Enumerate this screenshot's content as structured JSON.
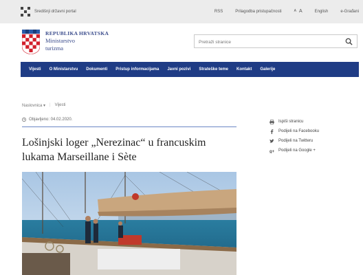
{
  "topbar": {
    "gov_label": "Središnji državni portal",
    "links": [
      "RSS",
      "Prilagodba pristupačnosti",
      "A",
      "A",
      "English",
      "e-Građani"
    ]
  },
  "header": {
    "ministry_line1": "REPUBLIKA HRVATSKA",
    "ministry_line2": "Ministarstvo",
    "ministry_line3": "turizma"
  },
  "search": {
    "placeholder": "Pretraži stranice"
  },
  "nav": {
    "items": [
      "Vijesti",
      "O Ministarstvu",
      "Dokumenti",
      "Pristup informacijama",
      "Javni pozivi",
      "Strateške teme",
      "Kontakt",
      "Galerije"
    ]
  },
  "breadcrumb": {
    "home": "Naslovnica",
    "current": "Vijesti"
  },
  "article": {
    "date": "Objavljeno: 04.02.2020.",
    "title": "Lošinjski loger „Nerezinac“ u francuskim lukama Marseillane i Sète"
  },
  "share": {
    "items": [
      "Ispiši stranicu",
      "Podijeli na Facebooku",
      "Podijeli na Twitteru",
      "Podijeli na Google +"
    ]
  },
  "colors": {
    "nav_bg": "#1f3c85",
    "accent": "#3b4c8c",
    "topbar_bg": "#ececec"
  }
}
